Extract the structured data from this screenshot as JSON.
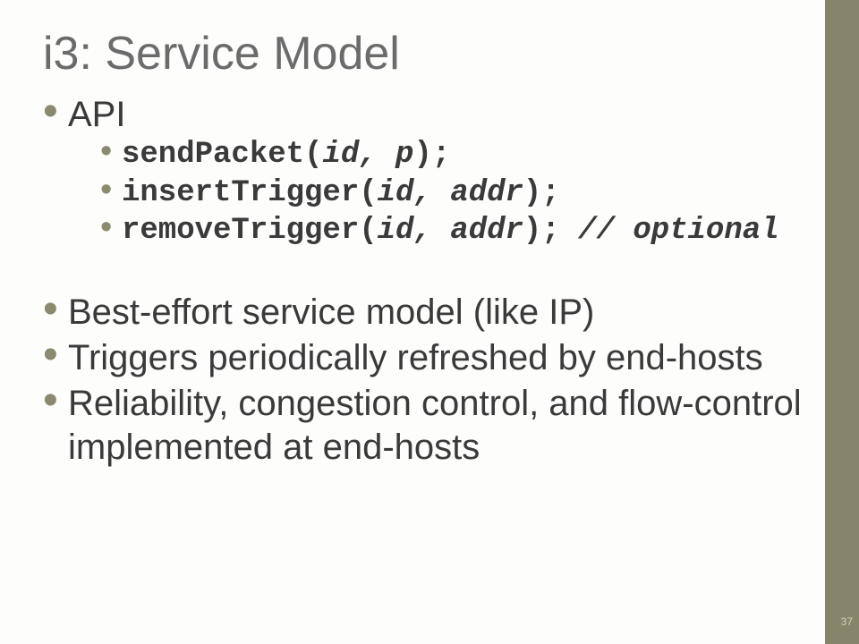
{
  "title": "i3: Service Model",
  "bullets": {
    "b0": "API",
    "sub": {
      "s0a": "sendPacket(",
      "s0b": "id, p",
      "s0c": ");",
      "s1a": "insertTrigger(",
      "s1b": "id, addr",
      "s1c": ");",
      "s2a": "removeTrigger(",
      "s2b": "id, addr",
      "s2c": "); ",
      "s2d": "// optional"
    },
    "b1": "Best-effort service model (like IP)",
    "b2": "Triggers periodically refreshed by end-hosts",
    "b3": "Reliability, congestion control, and flow-control implemented at end-hosts"
  },
  "page_number": "37"
}
